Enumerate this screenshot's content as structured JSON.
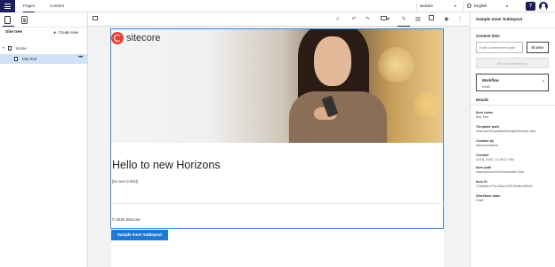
{
  "topbar": {
    "tabs": [
      {
        "label": "Pages",
        "active": true
      },
      {
        "label": "Content",
        "active": false
      }
    ],
    "site_select": "website",
    "language_select": "English",
    "help_label": "?"
  },
  "left_panel": {
    "title": "Site tree",
    "create_new": "Create new",
    "tree": [
      {
        "label": "Home",
        "level": 0,
        "expanded": true
      },
      {
        "label": "Mia Test",
        "level": 1,
        "selected": true,
        "more": "•••"
      }
    ]
  },
  "toolbar": {
    "icons": [
      "collapse-panel-icon",
      "check-icon",
      "undo-icon",
      "redo-icon",
      "device-icon",
      "edit-icon",
      "analytics-icon",
      "components-icon",
      "preview-icon",
      "more-icon"
    ]
  },
  "canvas": {
    "logo_text": "sitecore",
    "heading": "Hello to new Horizons",
    "field_placeholder": "[No text in field]",
    "copyright": "© 2020 Sitecore",
    "selected_chip": "Sample Inner Sublayout"
  },
  "right_panel": {
    "title": "Sample Inner Sublayout",
    "content_item_title": "Content item",
    "content_item_placeholder": "Enter content item path",
    "browse_label": "Browse",
    "remove_label": "Remove rendering",
    "workflow_title": "Workflow",
    "workflow_state": "Draft",
    "details_title": "Details",
    "details": [
      {
        "label": "Item name",
        "value": "Mia Test"
      },
      {
        "label": "Template path",
        "value": "/sitecore/templates/Sample/Sample Item"
      },
      {
        "label": "Created by",
        "value": "sitecore\\Admin"
      },
      {
        "label": "Created",
        "value": "Oct 8, 2020, 11:45:27 AM"
      },
      {
        "label": "Item path",
        "value": "/sitecore/content/Home/Mia Test"
      },
      {
        "label": "Item ID",
        "value": "723ac9be-e7ba-42ca-b925-540abe4551fe"
      },
      {
        "label": "Workflow state",
        "value": "Draft"
      }
    ]
  },
  "colors": {
    "brand": "#1b1f5b",
    "selection": "#3d8bd6",
    "chip": "#1e78d4",
    "tree_selected": "#cfe3f6"
  }
}
